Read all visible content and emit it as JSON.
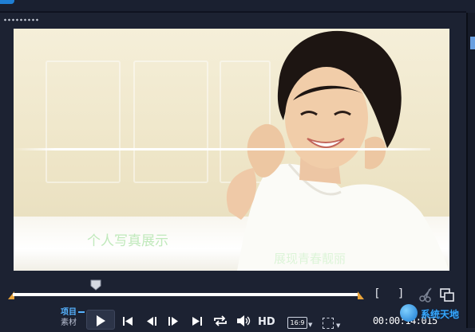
{
  "preview": {
    "caption_main": "个人写真展示",
    "caption_secondary": "展现青春靓丽",
    "image_name": "portrait-photo"
  },
  "timeline": {
    "position": 0.24,
    "mark_in_label": "[",
    "mark_out_label": "]"
  },
  "modes": {
    "project": "项目",
    "clip": "素材"
  },
  "controls": {
    "hd_label": "HD",
    "aspect_label": "16:9",
    "timecode": "00:00:14:015"
  },
  "brand": {
    "text": "系统天地"
  },
  "colors": {
    "background": "#1c2232",
    "accent": "#56b3ff",
    "marker": "#e8a33a"
  }
}
